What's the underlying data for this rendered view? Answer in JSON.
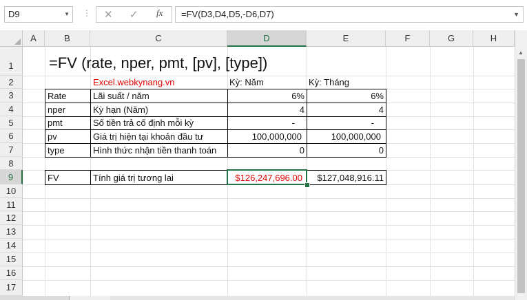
{
  "name_box": "D9",
  "formula": "=FV(D3,D4,D5,-D6,D7)",
  "icons": {
    "cancel": "✕",
    "enter": "✓",
    "fx": "fx"
  },
  "columns": [
    "A",
    "B",
    "C",
    "D",
    "E",
    "F",
    "G",
    "H"
  ],
  "rows": [
    "1",
    "2",
    "3",
    "4",
    "5",
    "6",
    "7",
    "8",
    "9",
    "10",
    "11",
    "12",
    "13",
    "14",
    "15",
    "16",
    "17"
  ],
  "title": "=FV (rate, nper, pmt, [pv], [type])",
  "site": "Excel.webkynang.vn",
  "header_d": "Kỳ: Năm",
  "header_e": "Kỳ: Tháng",
  "table": [
    {
      "key": "Rate",
      "desc": "Lãi suất / năm",
      "d": "6%",
      "e": "6%"
    },
    {
      "key": "nper",
      "desc": "Kỳ hạn (Năm)",
      "d": "4",
      "e": "4"
    },
    {
      "key": "pmt",
      "desc": "Số tiền trả cố định mỗi kỳ",
      "d": "-",
      "e": "-"
    },
    {
      "key": "pv",
      "desc": "Giá trị hiện tại khoản đầu tư",
      "d": "100,000,000",
      "e": "100,000,000"
    },
    {
      "key": "type",
      "desc": "Hình thức nhận tiền thanh toán",
      "d": "0",
      "e": "0"
    }
  ],
  "fv_row": {
    "key": "FV",
    "desc": "Tính giá trị tương lai",
    "d": "$126,247,696.00",
    "e": "$127,048,916.11"
  },
  "colors": {
    "accent": "#217346",
    "red": "#e00000"
  }
}
